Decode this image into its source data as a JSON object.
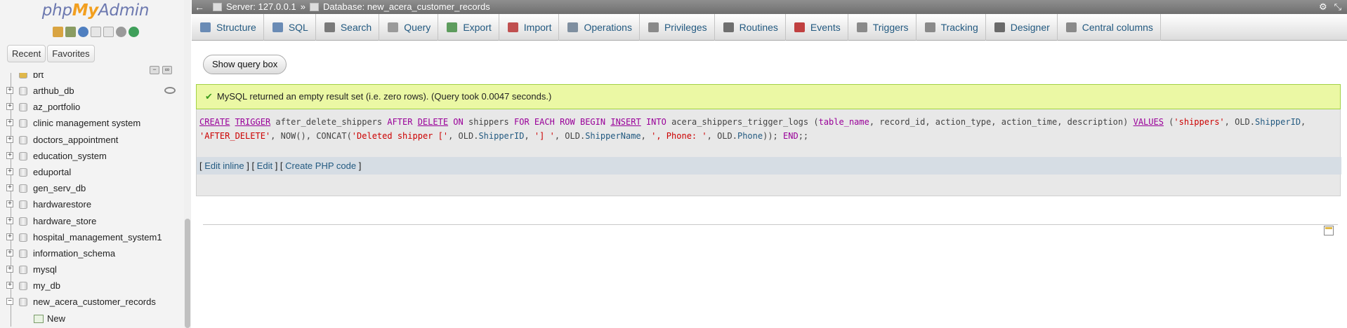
{
  "nav": {
    "logo_php": "php",
    "logo_my": "My",
    "logo_admin": "Admin",
    "icons": [
      "home-icon",
      "logout-icon",
      "help-icon",
      "docs-icon",
      "copy-icon",
      "settings-icon",
      "reload-icon"
    ],
    "recent_label": "Recent",
    "favorites_label": "Favorites",
    "partial_item": "brt",
    "databases": [
      "arthub_db",
      "az_portfolio",
      "clinic management system",
      "doctors_appointment",
      "education_system",
      "eduportal",
      "gen_serv_db",
      "hardwarestore",
      "hardware_store",
      "hospital_management_system1",
      "information_schema",
      "mysql",
      "my_db",
      "new_acera_customer_records"
    ],
    "new_label": "New"
  },
  "topbar": {
    "server": "Server: 127.0.0.1",
    "sep": "»",
    "database": "Database: new_acera_customer_records"
  },
  "menu": {
    "tabs": [
      {
        "label": "Structure",
        "icon": "structure-icon",
        "color": "#6a8bb5"
      },
      {
        "label": "SQL",
        "icon": "sql-icon",
        "color": "#6a8bb5"
      },
      {
        "label": "Search",
        "icon": "search-icon",
        "color": "#7a7a7a"
      },
      {
        "label": "Query",
        "icon": "query-icon",
        "color": "#9a9a9a"
      },
      {
        "label": "Export",
        "icon": "export-icon",
        "color": "#5d9c5d"
      },
      {
        "label": "Import",
        "icon": "import-icon",
        "color": "#c05050"
      },
      {
        "label": "Operations",
        "icon": "wrench-icon",
        "color": "#7f8fa0"
      },
      {
        "label": "Privileges",
        "icon": "privileges-icon",
        "color": "#8a8a8a"
      },
      {
        "label": "Routines",
        "icon": "routines-icon",
        "color": "#6f6f6f"
      },
      {
        "label": "Events",
        "icon": "clock-icon",
        "color": "#c04040"
      },
      {
        "label": "Triggers",
        "icon": "triggers-icon",
        "color": "#8a8a8a"
      },
      {
        "label": "Tracking",
        "icon": "eye-icon",
        "color": "#8a8a8a"
      },
      {
        "label": "Designer",
        "icon": "designer-icon",
        "color": "#6a6a6a"
      },
      {
        "label": "Central columns",
        "icon": "central-columns-icon",
        "color": "#8a8a8a"
      }
    ]
  },
  "main": {
    "show_query_label": "Show query box",
    "success_message": "MySQL returned an empty result set (i.e. zero rows). (Query took 0.0047 seconds.)",
    "sql": {
      "create": "CREATE",
      "trigger": "TRIGGER",
      "name": " after_delete_shippers ",
      "after": "AFTER",
      "delete": "DELETE",
      "on": "ON",
      "table": " shippers ",
      "for": "FOR",
      "each": "EACH",
      "row": "ROW",
      "begin": "BEGIN",
      "insert": "INSERT",
      "into": "INTO",
      "target": " acera_shippers_trigger_logs (",
      "c1": "table_name",
      "c2": "record_id",
      "c3": "action_type",
      "c4": "action_time",
      "c5": "description",
      "values": "VALUES",
      "v_open": " (",
      "s1": "'shippers'",
      "old1": "OLD.",
      "f1": "ShipperID",
      "s2": "'AFTER_DELETE'",
      "now": "NOW",
      "concat": "CONCAT",
      "s3": "'Deleted shipper ['",
      "old2": "OLD.",
      "f2": "ShipperID",
      "s4": "'] '",
      "old3": "OLD.",
      "f3": "ShipperName",
      "s5": "', Phone: '",
      "old4": "OLD.",
      "f4": "Phone",
      "end": "END",
      "tail": ";;"
    },
    "actions": {
      "edit_inline": "Edit inline",
      "edit": "Edit",
      "create_php": "Create PHP code"
    }
  },
  "colors": {
    "nav_bg": "#f3f3f3",
    "topbar_bg": "#787878",
    "success_bg": "#ebf8a4",
    "link": "#235a81",
    "keyword": "#990099",
    "string": "#cc0000"
  }
}
